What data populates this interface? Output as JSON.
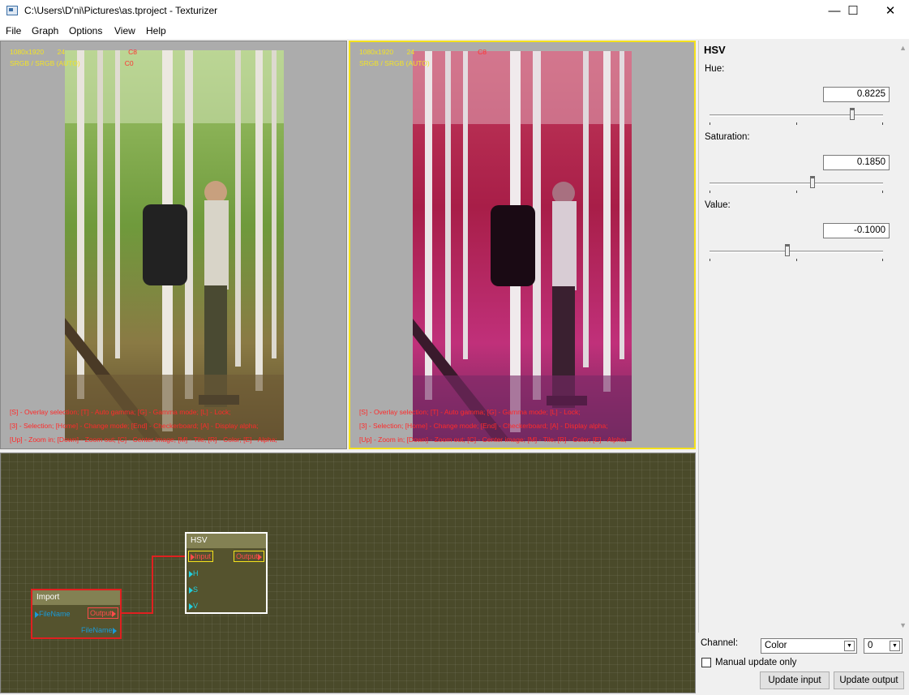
{
  "window": {
    "title": "C:\\Users\\D'ni\\Pictures\\as.tproject - Texturizer",
    "controls": {
      "minimize": "—",
      "maximize": "☐",
      "close": "✕"
    }
  },
  "menu": [
    "File",
    "Graph",
    "Options",
    "View",
    "Help"
  ],
  "viewports": {
    "left": {
      "resolution": "1080x1920",
      "depth": "24",
      "channel": "C8",
      "colorspace": "SRGB / SRGB (AUTO)",
      "channel2": "C0",
      "help_lines": [
        "[S] - Overlay selection; [T] - Auto gamma; [G] - Gamma mode; [L] - Lock;",
        "[3] - Selection; [Home] - Change mode; [End] - Checkerboard; [A] - Display alpha;",
        "[Up] - Zoom in; [Down] - Zoom out; [C] - Center image; [M] - Tile; [R] - Color; [E] - Alpha;"
      ]
    },
    "right": {
      "resolution": "1080x1920",
      "depth": "24",
      "channel": "C8",
      "colorspace": "SRGB / SRGB (AUTO)",
      "channel2": "",
      "help_lines": [
        "[S] - Overlay selection; [T] - Auto gamma; [G] - Gamma mode; [L] - Lock;",
        "[3] - Selection; [Home] - Change mode; [End] - Checkerboard; [A] - Display alpha;",
        "[Up] - Zoom in; [Down] - Zoom out; [C] - Center image; [M] - Tile; [R] - Color; [E] - Alpha;"
      ]
    }
  },
  "graph": {
    "nodes": {
      "import": {
        "title": "Import",
        "in_port": "FileName",
        "out_port": "Output",
        "out_port2": "FileName"
      },
      "hsv": {
        "title": "HSV",
        "in_port": "Input",
        "out_port": "Output",
        "params": [
          "H",
          "S",
          "V"
        ]
      }
    }
  },
  "panel": {
    "title": "HSV",
    "params": [
      {
        "label": "Hue:",
        "value": "0.8225",
        "fraction": 0.8225
      },
      {
        "label": "Saturation:",
        "value": "0.1850",
        "fraction": 0.5925
      },
      {
        "label": "Value:",
        "value": "-0.1000",
        "fraction": 0.45
      }
    ]
  },
  "bottom": {
    "channel_label": "Channel:",
    "channel_value": "Color",
    "index_value": "0",
    "manual_update_label": "Manual update only",
    "manual_update_checked": false,
    "update_input_label": "Update input",
    "update_output_label": "Update output"
  },
  "colors": {
    "viewport_bg": "#acacac",
    "active_viewport_border": "#f5e21c",
    "graph_bg": "#4a4a2a",
    "selected_node_border": "#e02020",
    "info_text": "#f3e326",
    "help_text": "#ff2a2a",
    "port_cyan": "#20d0e0"
  }
}
